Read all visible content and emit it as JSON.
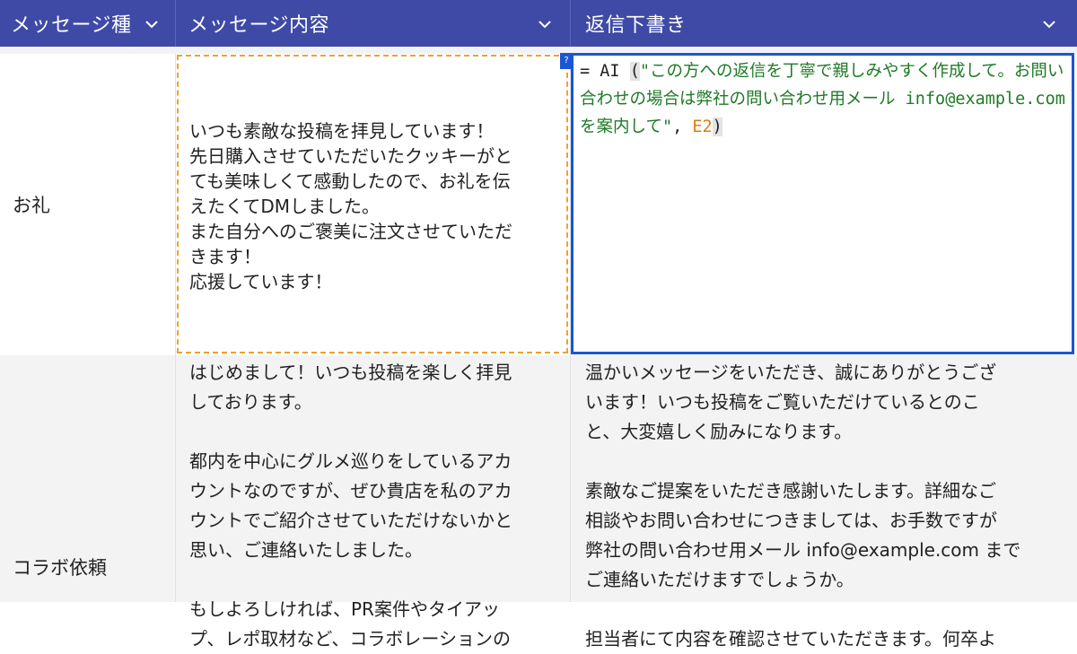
{
  "header": {
    "col_type": "メッセージ種",
    "col_message": "メッセージ内容",
    "col_reply": "返信下書き"
  },
  "rows": [
    {
      "type": "お礼",
      "message": "いつも素敵な投稿を拝見しています！\n先日購入させていただいたクッキーがと\nても美味しくて感動したので、お礼を伝\nえたくてDMしました。\nまた自分へのご褒美に注文させていただ\nきます！\n応援しています！",
      "formula": {
        "prefix": "= AI ",
        "open_paren": "(",
        "string": "\"この方への返信を丁寧で親しみやすく作成して。お問い合わせの場合は弊社の問い合わせ用メール info@example.com を案内して\"",
        "separator": ", ",
        "ref": "E2",
        "close_paren": ")"
      }
    },
    {
      "type": "コラボ依頼",
      "message": "はじめまして！いつも投稿を楽しく拝見\nしております。\n\n都内を中心にグルメ巡りをしているアカ\nウントなのですが、ぜひ貴店を私のアカ\nウントでご紹介させていただけないかと\n思い、ご連絡いたしました。\n\nもしよろしければ、PR案件やタイアッ\nプ、レポ取材など、コラボレーションの",
      "reply": "温かいメッセージをいただき、誠にありがとうござ\nいます！いつも投稿をご覧いただけているとのこ\nと、大変嬉しく励みになります。\n\n素敵なご提案をいただき感謝いたします。詳細なご\n相談やお問い合わせにつきましては、お手数ですが\n弊社の問い合わせ用メール info@example.com まで\nご連絡いただけますでしょうか。\n\n担当者にて内容を確認させていただきます。何卒よ"
    }
  ],
  "help_badge": "?",
  "colors": {
    "header_bg": "#3f4aa6",
    "active_border": "#1a56d6",
    "copy_border": "#f0a030",
    "string": "#1e7a25",
    "ref": "#e07b10"
  },
  "icons": {
    "column_menu": "chevron-down-icon"
  }
}
